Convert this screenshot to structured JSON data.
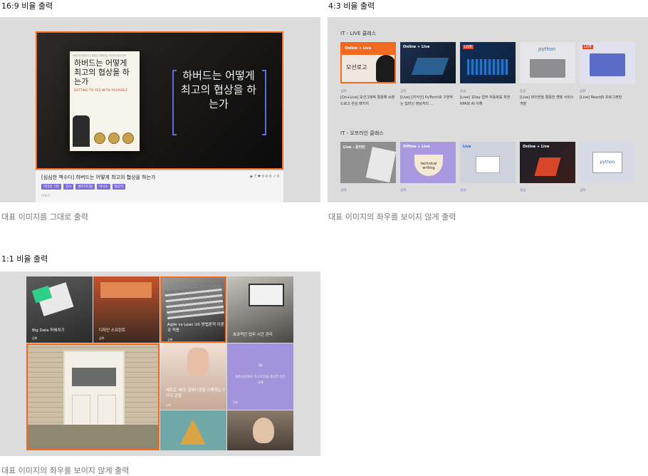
{
  "sections": {
    "s169_title": "16:9 비율 출력",
    "s169_caption": "대표 이미지를 그대로 출력",
    "s43_title": "4:3 비율 출력",
    "s43_caption": "대표 이미지의 좌우를 보이지 않게 출력",
    "s11_title": "1:1 비율 출력",
    "s11_caption": "대표 이미지의 좌우를 보이지 않게 출력"
  },
  "video": {
    "book_tiny": "하버드대 협상연구소 클로브가 알려주는 자신과의 협상 전략",
    "book_title": "하버드는 어떻게 최고의 협상을 하는가",
    "book_subtitle": "GETTING TO YES WITH YOURSELF",
    "big_title": "하버드는 어떻게 최고의 협상을 하는가",
    "title": "[심심한 책수다] 하버드는 어떻게 최고의 협상을 하는가",
    "stats": "▶ 7   ♥ 0   ✉ 0   ↗ 0",
    "tags": [
      "리더의 기본",
      "감사",
      "셀프리더쉽",
      "의사소",
      "협상력"
    ],
    "more": "더보기"
  },
  "it_live": {
    "heading": "IT - LIVE 클래스",
    "cards": [
      {
        "badge": "Online + Live",
        "inner": "모션로고",
        "cat": "심화",
        "text": "[On+Live] 모션그래픽 활용해 브랜드로고 완성 패키지"
      },
      {
        "badge": "Online + Live",
        "inner": "",
        "cat": "심화",
        "text": "[Live] [지식인] PyTorch로 구현하는 딥러닝 영상처리 ..."
      },
      {
        "badge": "LIVE",
        "inner": "",
        "cat": "중급",
        "text": "[Live] 1Day 업무 자동화를 위한 RPA와 AI 이해"
      },
      {
        "badge": "python",
        "inner": "",
        "cat": "중급",
        "text": "[Live] 파이썬을 활용한 챗봇 서비스 개발"
      },
      {
        "badge": "LIVE",
        "inner": "",
        "cat": "심화",
        "text": "[Live] ReactJS 프로그래밍"
      }
    ]
  },
  "it_offline": {
    "heading": "IT - 오프라인 클래스",
    "cards": [
      {
        "badge": "Live - 온라인",
        "inner": "",
        "cat": "심화"
      },
      {
        "badge": "Offline + Live",
        "inner": "technical writing",
        "cat": "심화"
      },
      {
        "badge": "Live",
        "inner": "",
        "cat": "중급"
      },
      {
        "badge": "Online + Live",
        "inner": "",
        "cat": "중급"
      },
      {
        "badge": "python",
        "inner": "",
        "cat": "심화"
      }
    ]
  },
  "grid11": {
    "tiles": [
      {
        "caption": "Big Data 파헤치기",
        "cat": "심화"
      },
      {
        "caption": "디자인 스프린트",
        "cat": "심화"
      },
      {
        "caption": "Agile vs Lean UX 방법론적 이론과 적용",
        "cat": "심화"
      },
      {
        "caption": "효과적인 업무 시간 관리",
        "cat": ""
      },
      {
        "caption": "",
        "cat": ""
      },
      {
        "caption": "새로운 세대, 밀레니얼을 이해하는 7가지 관점",
        "cat": "심화"
      },
      {
        "caption": "해외시장에서 코스트코를 성공한 작은 사례",
        "cat": "기초"
      },
      {
        "caption": "",
        "cat": ""
      },
      {
        "caption": "",
        "cat": ""
      }
    ]
  },
  "colors": {
    "accent": "#f26a21",
    "purple": "#7f6ad6",
    "panel": "#dcdcdc"
  }
}
